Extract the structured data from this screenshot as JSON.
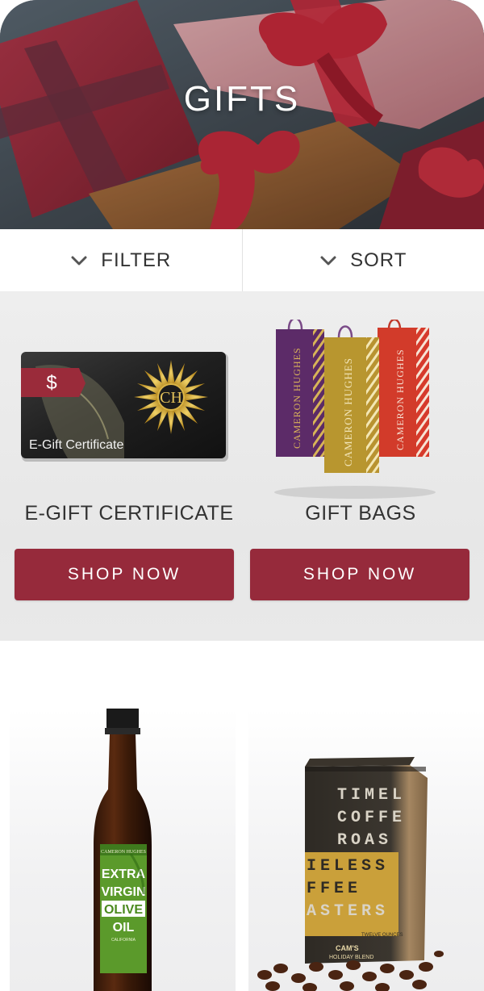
{
  "hero": {
    "title": "GIFTS"
  },
  "controls": {
    "filter_label": "FILTER",
    "sort_label": "SORT"
  },
  "featured": [
    {
      "title": "E-GIFT CERTIFICATE",
      "button": "SHOP NOW",
      "image_text": {
        "badge": "$",
        "caption": "E-Gift Certificate",
        "monogram": "CH"
      }
    },
    {
      "title": "GIFT BAGS",
      "button": "SHOP NOW",
      "image_text": {
        "brand": "CAMERON HUGHES"
      }
    }
  ],
  "products": [
    {
      "name": "olive-oil",
      "label_lines": [
        "EXTRA",
        "VIRGIN",
        "OLIVE",
        "OIL"
      ],
      "brand": "CAMERON HUGHES",
      "region": "CALIFORNIA"
    },
    {
      "name": "coffee",
      "label_lines": [
        "TIMEL",
        "COFFE",
        "ROAS",
        "IELESS",
        "FFEE",
        "ASTERS"
      ],
      "flavor": "CAM'S",
      "blend": "HOLIDAY BLEND",
      "weight": "TWELVE OUNCES"
    }
  ],
  "colors": {
    "accent": "#962a3b",
    "hero_ribbon": "#b8283c",
    "gold": "#c9a233"
  }
}
